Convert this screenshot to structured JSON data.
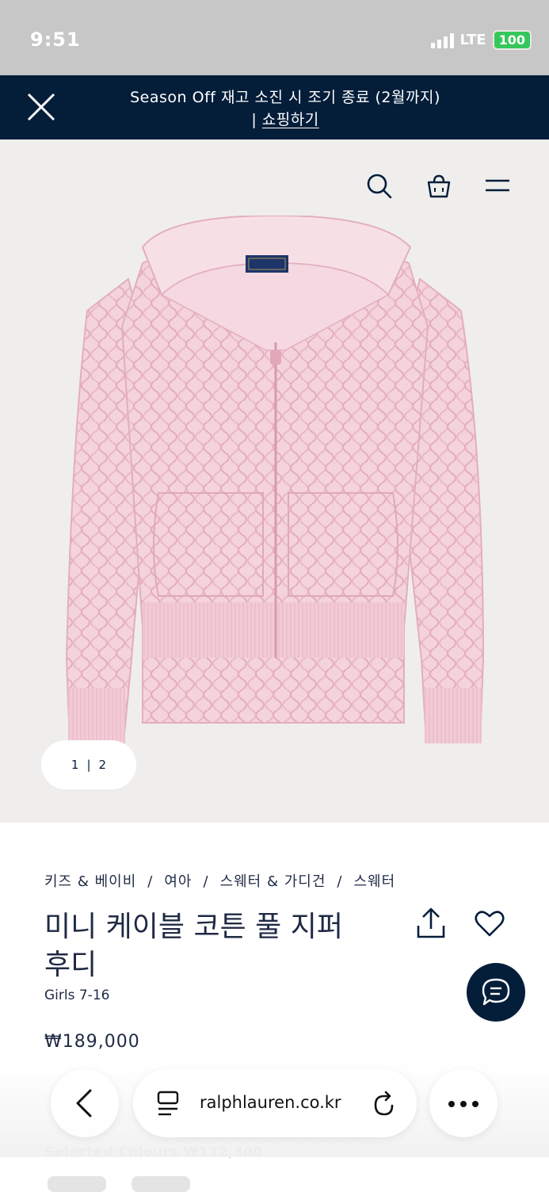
{
  "status_bar": {
    "time": "9:51",
    "network": "LTE",
    "battery": "100"
  },
  "banner": {
    "text": "Season Off 재고 소진 시 조기 종료 (2월까지)",
    "divider": "|",
    "link": "쇼핑하기"
  },
  "header_icons": [
    "search-icon",
    "shopping-bag-icon",
    "menu-icon"
  ],
  "pager": {
    "current": "1",
    "separator": "|",
    "total": "2"
  },
  "breadcrumb": {
    "items": [
      "키즈 & 베이비",
      "여아",
      "스웨터 & 가디건",
      "스웨터"
    ],
    "separator": "/"
  },
  "product": {
    "title": "미니 케이블 코튼 풀 지퍼 후디",
    "subtitle": "Girls 7-16",
    "price": "₩189,000",
    "selected_colours": "Selected Colours ₩132,300"
  },
  "safari": {
    "url": "ralphlauren.co.kr"
  },
  "colors": {
    "navy": "#041e3a",
    "pink": "#f4d3dc",
    "hero_bg": "#efeeed"
  }
}
